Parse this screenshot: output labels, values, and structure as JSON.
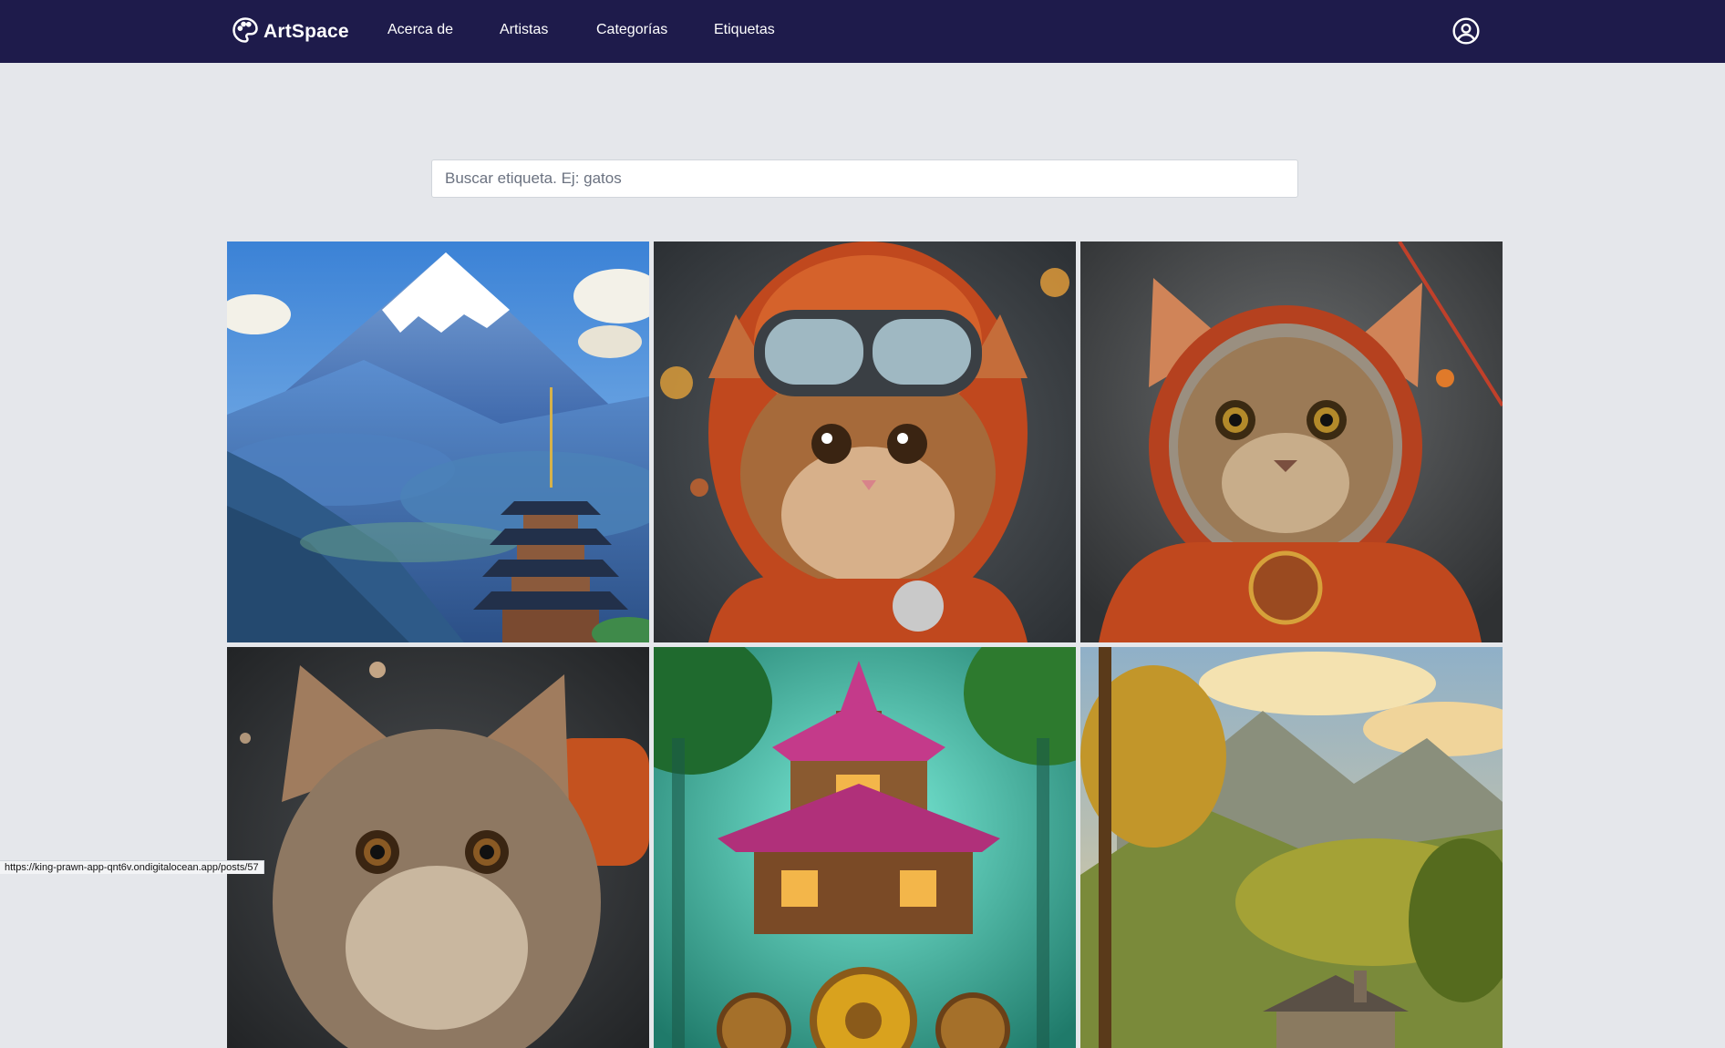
{
  "header": {
    "brand": "ArtSpace",
    "brand_icon": "palette-icon",
    "nav": [
      {
        "label": "Acerca de"
      },
      {
        "label": "Artistas"
      },
      {
        "label": "Categorías"
      },
      {
        "label": "Etiquetas"
      }
    ],
    "user_icon": "user-circle-icon",
    "background_color": "#1e1b4b"
  },
  "search": {
    "placeholder": "Buscar etiqueta. Ej: gatos",
    "value": ""
  },
  "gallery": {
    "items": [
      {
        "alt": "Monte Fuji con pagoda"
      },
      {
        "alt": "Gato con gafas de esquí"
      },
      {
        "alt": "Gato astronauta"
      },
      {
        "alt": "Gatito atigrado"
      },
      {
        "alt": "Casa steampunk en el bosque"
      },
      {
        "alt": "Paisaje de montaña con cabaña"
      }
    ]
  },
  "status_bar": {
    "url": "https://king-prawn-app-qnt6v.ondigitalocean.app/posts/57"
  }
}
